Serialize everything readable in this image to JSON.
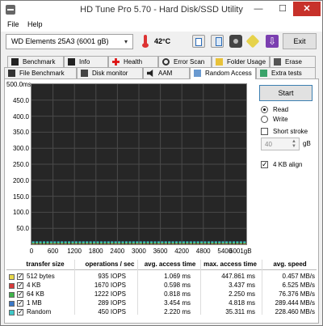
{
  "window": {
    "title": "HD Tune Pro 5.70 - Hard Disk/SSD Utility",
    "minimize": "—",
    "maximize": "☐",
    "close": "✕"
  },
  "menu": {
    "file": "File",
    "help": "Help"
  },
  "toolbar": {
    "drive": "WD    Elements 25A3 (6001 gB)",
    "temperature": "42°C",
    "exit": "Exit",
    "icons": [
      "copy-text-icon",
      "copy-screen-icon",
      "screenshot-icon",
      "options-icon",
      "download-icon"
    ]
  },
  "tabs_row1": [
    "Benchmark",
    "Info",
    "Health",
    "Error Scan",
    "Folder Usage",
    "Erase"
  ],
  "tabs_row2": [
    "File Benchmark",
    "Disk monitor",
    "AAM",
    "Random Access",
    "Extra tests"
  ],
  "active_tab": "Random Access",
  "controls": {
    "start": "Start",
    "read": "Read",
    "write": "Write",
    "short_stroke": "Short stroke",
    "short_stroke_value": "40",
    "short_stroke_unit": "gB",
    "align": "4 KB align",
    "read_selected": true,
    "align_checked": true
  },
  "chart_data": {
    "type": "scatter",
    "title": "",
    "xlabel": "",
    "ylabel": "",
    "xlim": [
      0,
      6000
    ],
    "ylim": [
      0,
      500
    ],
    "x_tick_labels": [
      "0",
      "600",
      "1200",
      "1800",
      "2400",
      "3000",
      "3600",
      "4200",
      "4800",
      "5400",
      "6001gB"
    ],
    "y_tick_labels": [
      "500.0ms",
      "450.0",
      "400.0",
      "350.0",
      "300.0",
      "250.0",
      "200.0",
      "150.0",
      "100.0",
      "50.0"
    ],
    "grid": true,
    "colors": {
      "background": "#262626",
      "grid": "#4a4a4a",
      "scatter": "#3fb8c8"
    },
    "series": [
      {
        "name": "512 bytes",
        "color": "#e8d84a",
        "avg_access_ms": 1.069
      },
      {
        "name": "4 KB",
        "color": "#d83a3a",
        "avg_access_ms": 0.598
      },
      {
        "name": "64 KB",
        "color": "#3fb34a",
        "avg_access_ms": 0.818
      },
      {
        "name": "1 MB",
        "color": "#3a78c8",
        "avg_access_ms": 3.454
      },
      {
        "name": "Random",
        "color": "#3fc8c8",
        "avg_access_ms": 2.22
      }
    ]
  },
  "table": {
    "headers": [
      "transfer size",
      "operations / sec",
      "avg. access time",
      "max. access time",
      "avg. speed"
    ],
    "rows": [
      {
        "label": "512 bytes",
        "color": "#e8d84a",
        "ops": "935 IOPS",
        "avg": "1.069 ms",
        "max": "447.861 ms",
        "speed": "0.457 MB/s"
      },
      {
        "label": "4 KB",
        "color": "#d83a3a",
        "ops": "1670 IOPS",
        "avg": "0.598 ms",
        "max": "3.437 ms",
        "speed": "6.525 MB/s"
      },
      {
        "label": "64 KB",
        "color": "#3fb34a",
        "ops": "1222 IOPS",
        "avg": "0.818 ms",
        "max": "2.250 ms",
        "speed": "76.376 MB/s"
      },
      {
        "label": "1 MB",
        "color": "#3a78c8",
        "ops": "289 IOPS",
        "avg": "3.454 ms",
        "max": "4.818 ms",
        "speed": "289.444 MB/s"
      },
      {
        "label": "Random",
        "color": "#3fc8c8",
        "ops": "450 IOPS",
        "avg": "2.220 ms",
        "max": "35.311 ms",
        "speed": "228.460 MB/s"
      }
    ]
  }
}
